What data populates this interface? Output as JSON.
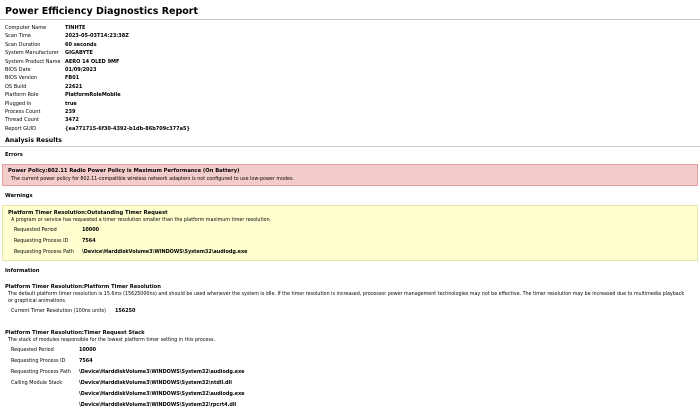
{
  "report": {
    "title": "Power Efficiency Diagnostics Report"
  },
  "system_info": [
    {
      "label": "Computer Name",
      "value": "TINHTE"
    },
    {
      "label": "Scan Time",
      "value": "2023-05-03T14:23:38Z"
    },
    {
      "label": "Scan Duration",
      "value": "60 seconds"
    },
    {
      "label": "System Manufacturer",
      "value": "GIGABYTE"
    },
    {
      "label": "System Product Name",
      "value": "AERO 14 OLED 9MF"
    },
    {
      "label": "BIOS Date",
      "value": "01/09/2023"
    },
    {
      "label": "BIOS Version",
      "value": "FB01"
    },
    {
      "label": "OS Build",
      "value": "22621"
    },
    {
      "label": "Platform Role",
      "value": "PlatformRoleMobile"
    },
    {
      "label": "Plugged In",
      "value": "true"
    },
    {
      "label": "Process Count",
      "value": "239"
    },
    {
      "label": "Thread Count",
      "value": "3472"
    },
    {
      "label": "Report GUID",
      "value": "{ea771715-6f30-4392-b1db-86b709c377a5}"
    }
  ],
  "sections": {
    "analysis_results": "Analysis Results",
    "errors": "Errors",
    "warnings": "Warnings",
    "information": "Information"
  },
  "error": {
    "title": "Power Policy:802.11 Radio Power Policy is Maximum Performance (On Battery)",
    "description": "The current power policy for 802.11-compatible wireless network adapters is not configured to use low-power modes."
  },
  "warning": {
    "title": "Platform Timer Resolution:Outstanding Timer Request",
    "description": "A program or service has requested a timer resolution smaller than the platform maximum timer resolution.",
    "fields": [
      {
        "label": "Requested Period",
        "value": "10000"
      },
      {
        "label": "Requesting Process ID",
        "value": "7564"
      },
      {
        "label": "Requesting Process Path",
        "value": "\\Device\\HarddiskVolume3\\WINDOWS\\System32\\audiodg.exe"
      }
    ]
  },
  "info_platform": {
    "title": "Platform Timer Resolution:Platform Timer Resolution",
    "description": "The default platform timer resolution is 15.6ms (15625000ns) and should be used whenever the system is idle. If the timer resolution is increased, processor power management technologies may not be effective. The timer resolution may be increased due to multimedia playback or graphical animations.",
    "field": {
      "label": "Current Timer Resolution (100ns units)",
      "value": "156250"
    }
  },
  "info_stack": {
    "title": "Platform Timer Resolution:Timer Request Stack",
    "description": "The stack of modules responsible for the lowest platform timer setting in this process.",
    "fields": [
      {
        "label": "Requested Period",
        "value": "10000"
      },
      {
        "label": "Requesting Process ID",
        "value": "7564"
      },
      {
        "label": "Requesting Process Path",
        "value": "\\Device\\HarddiskVolume3\\WINDOWS\\System32\\audiodg.exe"
      },
      {
        "label": "Calling Module Stack",
        "value": "\\Device\\HarddiskVolume3\\WINDOWS\\System32\\ntdll.dll"
      },
      {
        "label": "",
        "value": "\\Device\\HarddiskVolume3\\WINDOWS\\System32\\audiodg.exe"
      },
      {
        "label": "",
        "value": "\\Device\\HarddiskVolume3\\WINDOWS\\System32\\rpcrt4.dll"
      }
    ]
  }
}
